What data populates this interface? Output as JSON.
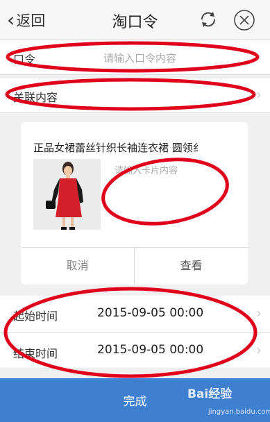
{
  "header": {
    "back_label": "返回",
    "title": "淘口令"
  },
  "command": {
    "label": "口令",
    "placeholder": "请输入口令内容"
  },
  "related": {
    "label": "关联内容"
  },
  "card": {
    "product_title": "正品女裙蕾丝针织长袖连衣裙 圆领纟",
    "placeholder": "请输入卡片内容",
    "cancel_label": "取消",
    "view_label": "查看"
  },
  "start_time": {
    "label": "起始时间",
    "value": "2015-09-05 00:00"
  },
  "end_time": {
    "label": "结束时间",
    "value": "2015-09-05 00:00"
  },
  "footer": {
    "done_label": "完成"
  },
  "watermark": {
    "brand": "Bai经验",
    "url": "jingyan.baidu.com"
  },
  "colors": {
    "primary": "#3e7fd0",
    "annotation": "#e0001b"
  }
}
